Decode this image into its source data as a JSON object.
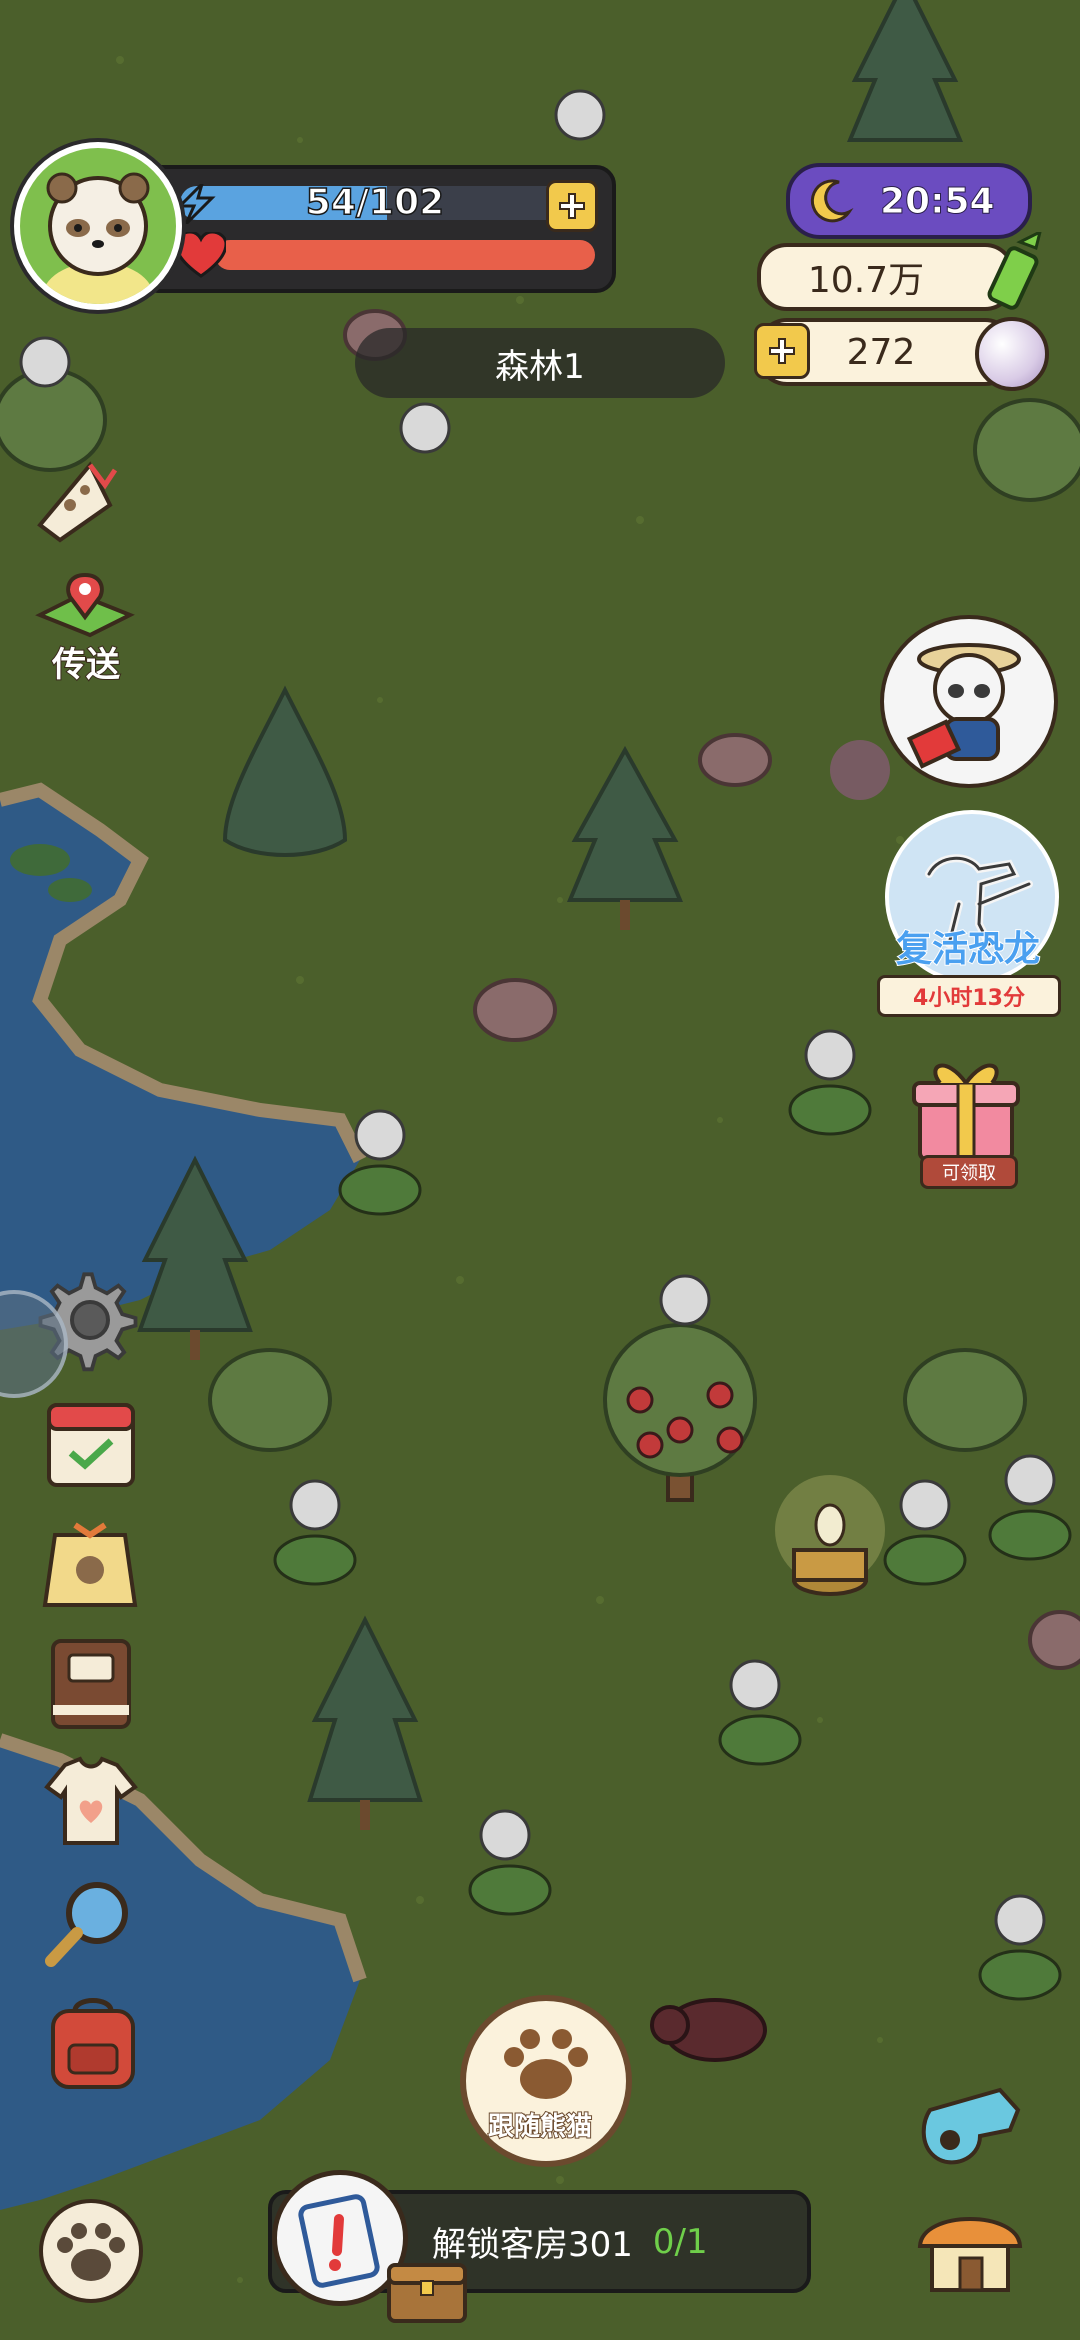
{
  "player": {
    "energy_text": "54/102",
    "energy_fraction": 0.53,
    "health_fraction": 1.0,
    "avatar_icon": "panda-avatar-icon"
  },
  "clock": {
    "time": "20:54",
    "icon": "moon-icon"
  },
  "currency": {
    "bamboo": "10.7万",
    "pearls": "272"
  },
  "location": {
    "name": "森林1"
  },
  "left_menu": {
    "teleport_label": "传送"
  },
  "right_panel": {
    "dino_event_label": "复活恐龙",
    "dino_event_timer": "4小时13分",
    "gift_label": "可领取"
  },
  "bottom": {
    "follow_panda_label": "跟随熊猫",
    "quest_text": "解锁客房301",
    "quest_progress": "0/1"
  },
  "colors": {
    "grass": "#4a5e2a",
    "water": "#2f5a86",
    "energy_bar": "#5aa3e0",
    "health_bar": "#e8604a",
    "clock_bg": "#6b4cc0",
    "accent_yellow": "#f2c94c"
  }
}
